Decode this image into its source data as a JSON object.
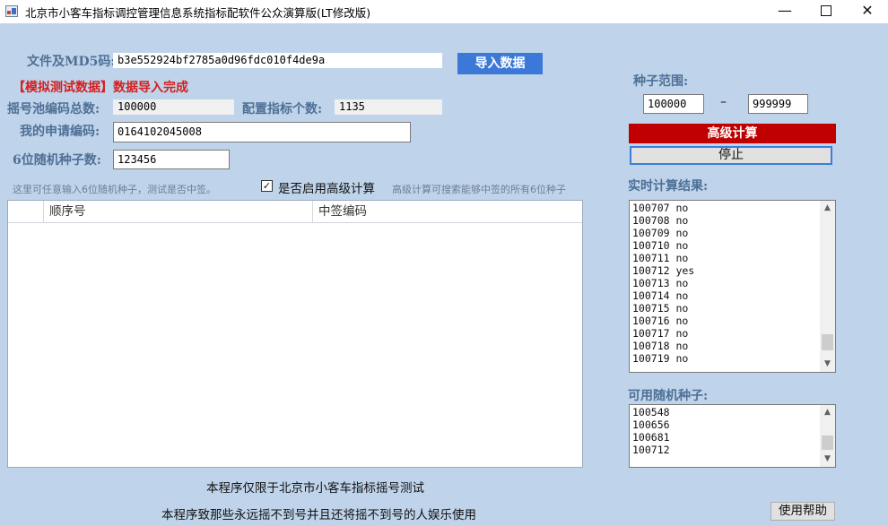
{
  "window": {
    "title": "北京市小客车指标调控管理信息系统指标配软件公众演算版(LT修改版)",
    "minimize_glyph": "—",
    "close_glyph": "✕"
  },
  "form": {
    "file_md5_label": "文件及MD5码:",
    "file_md5_value": "b3e552924bf2785a0d96fdc010f4de9a",
    "import_button": "导入数据",
    "status_message": "【模拟测试数据】数据导入完成",
    "pool_total_label": "摇号池编码总数:",
    "pool_total_value": "100000",
    "quota_count_label": "配置指标个数:",
    "quota_count_value": "1135",
    "my_code_label": "我的申请编码:",
    "my_code_value": "0164102045008",
    "seed_label": "6位随机种子数:",
    "seed_value": "123456",
    "seed_hint": "这里可任意输入6位随机种子，测试是否中签。",
    "advanced_checkbox_label": "是否启用高级计算",
    "advanced_checked": true,
    "advanced_hint": "高级计算可搜索能够中签的所有6位种子"
  },
  "grid": {
    "columns": [
      "",
      "顺序号",
      "中签编码"
    ]
  },
  "seed_range": {
    "label": "种子范围:",
    "from": "100000",
    "dash": "–",
    "to": "999999"
  },
  "advanced_calc_button": "高级计算",
  "stop_button": "停止",
  "realtime": {
    "label": "实时计算结果:",
    "items": [
      "100707 no",
      "100708 no",
      "100709 no",
      "100710 no",
      "100711 no",
      "100712 yes",
      "100713 no",
      "100714 no",
      "100715 no",
      "100716 no",
      "100717 no",
      "100718 no",
      "100719 no"
    ],
    "scroll_position": 0.95
  },
  "available": {
    "label": "可用随机种子:",
    "items": [
      "100548",
      "100656",
      "100681",
      "100712"
    ],
    "scroll_position": 0.9
  },
  "footer": {
    "line1": "本程序仅限于北京市小客车指标摇号测试",
    "line2": "本程序致那些永远摇不到号并且还将摇不到号的人娱乐使用",
    "help_button": "使用帮助"
  },
  "colors": {
    "background": "#bfd4ea",
    "label_text": "#4e6f96",
    "status_red": "#d42020",
    "import_button_bg": "#3c78d8",
    "advanced_button_bg": "#c00000"
  }
}
